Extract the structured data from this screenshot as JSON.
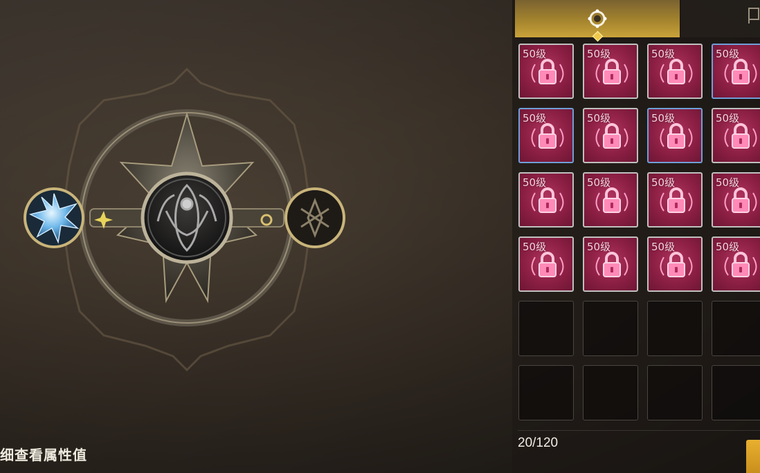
{
  "hint": {
    "text": "细查看属性值"
  },
  "inventory": {
    "count": "20/120",
    "level_label": "50级",
    "slots": [
      {
        "state": "locked",
        "border": "grey"
      },
      {
        "state": "locked",
        "border": "grey"
      },
      {
        "state": "locked",
        "border": "grey"
      },
      {
        "state": "locked",
        "border": "blue"
      },
      {
        "state": "locked",
        "border": "blue"
      },
      {
        "state": "locked",
        "border": "grey"
      },
      {
        "state": "locked",
        "border": "blue"
      },
      {
        "state": "locked",
        "border": "grey"
      },
      {
        "state": "locked",
        "border": "grey"
      },
      {
        "state": "locked",
        "border": "grey"
      },
      {
        "state": "locked",
        "border": "grey"
      },
      {
        "state": "locked",
        "border": "grey"
      },
      {
        "state": "locked",
        "border": "grey"
      },
      {
        "state": "locked",
        "border": "grey"
      },
      {
        "state": "locked",
        "border": "grey"
      },
      {
        "state": "locked",
        "border": "grey"
      },
      {
        "state": "empty"
      },
      {
        "state": "empty"
      },
      {
        "state": "empty"
      },
      {
        "state": "empty"
      },
      {
        "state": "empty"
      },
      {
        "state": "empty"
      },
      {
        "state": "empty"
      },
      {
        "state": "empty"
      }
    ]
  },
  "tabs": [
    {
      "icon": "ring-gem-icon",
      "active": true
    },
    {
      "icon": "banner-icon",
      "active": false
    }
  ],
  "emblem": {
    "left_socket_icon": "blue-star-gem-icon",
    "center_icon": "ornate-sigil-icon",
    "right_socket_icon": "dark-rune-icon"
  },
  "colors": {
    "accent_gold": "#c9a33a",
    "locked_slot": "#8c1f44",
    "lock_pink": "#ff7fb0",
    "blue_border": "#6f9fd8"
  }
}
